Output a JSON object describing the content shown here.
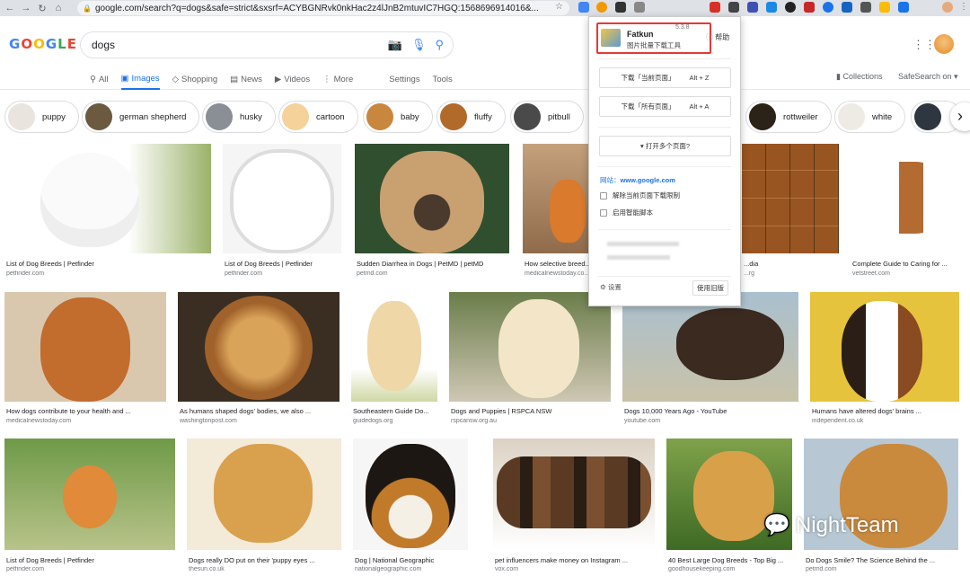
{
  "browser": {
    "url": "google.com/search?q=dogs&safe=strict&sxsrf=ACYBGNRvk0nkHac2z4lJnB2mtuvIC7HGQ:1568696914016&..."
  },
  "google": {
    "logo": "GOOGLE",
    "query": "dogs",
    "tabs": [
      {
        "label": "All",
        "icon": "search-icon"
      },
      {
        "label": "Images",
        "icon": "image-icon"
      },
      {
        "label": "Shopping",
        "icon": "tag-icon"
      },
      {
        "label": "News",
        "icon": "news-icon"
      },
      {
        "label": "Videos",
        "icon": "video-icon"
      },
      {
        "label": "More",
        "icon": "more-icon"
      }
    ],
    "settings": "Settings",
    "tools": "Tools",
    "collections": "Collections",
    "safesearch": "SafeSearch on ▾"
  },
  "chips": [
    "puppy",
    "german shepherd",
    "husky",
    "cartoon",
    "baby",
    "fluffy",
    "pitbull",
    "rottweiler",
    "white"
  ],
  "results": [
    {
      "caption": "List of Dog Breeds | Petfinder",
      "source": "petfinder.com"
    },
    {
      "caption": "List of Dog Breeds | Petfinder",
      "source": "petfinder.com"
    },
    {
      "caption": "Sudden Diarrhea in Dogs | PetMD | petMD",
      "source": "petmd.com"
    },
    {
      "caption": "How selective breed...",
      "source": "medicalnewstoday.co..."
    },
    {
      "caption": "...dia",
      "source": "...rg"
    },
    {
      "caption": "Complete Guide to Caring for ...",
      "source": "vetstreet.com"
    },
    {
      "caption": "How dogs contribute to your health and ...",
      "source": "medicalnewstoday.com"
    },
    {
      "caption": "As humans shaped dogs' bodies, we also ...",
      "source": "washingtonpost.com"
    },
    {
      "caption": "Southeastern Guide Do...",
      "source": "guidedogs.org"
    },
    {
      "caption": "Dogs and Puppies | RSPCA NSW",
      "source": "rspcansw.org.au"
    },
    {
      "caption": "Dogs 10,000 Years Ago - YouTube",
      "source": "youtube.com"
    },
    {
      "caption": "Humans have altered dogs' brains ...",
      "source": "independent.co.uk"
    },
    {
      "caption": "List of Dog Breeds | Petfinder",
      "source": "petfinder.com"
    },
    {
      "caption": "Dogs really DO put on their 'puppy eyes ...",
      "source": "thesun.co.uk"
    },
    {
      "caption": "Dog | National Geographic",
      "source": "nationalgeographic.com"
    },
    {
      "caption": "pet influencers make money on Instagram ...",
      "source": "vox.com"
    },
    {
      "caption": "40 Best Large Dog Breeds - Top Big ...",
      "source": "goodhousekeeping.com"
    },
    {
      "caption": "Do Dogs Smile? The Science Behind the ...",
      "source": "petmd.com"
    }
  ],
  "popup": {
    "name": "Fatkun",
    "version": "5.3.8",
    "subtitle": "图片批量下载工具",
    "help": "帮助",
    "btn_current": "下载「当前页面」",
    "btn_current_key": "Alt + Z",
    "btn_all": "下载「所有页面」",
    "btn_all_key": "Alt + A",
    "btn_multi": "▾  打开多个页面?",
    "site_label": "网站：",
    "site_value": "www.google.com",
    "opt_unlock": "解除当前页面下载限制",
    "opt_smart": "启用智能脚本",
    "settings": "设置",
    "old_version": "使用旧版"
  },
  "watermark": "NightTeam"
}
